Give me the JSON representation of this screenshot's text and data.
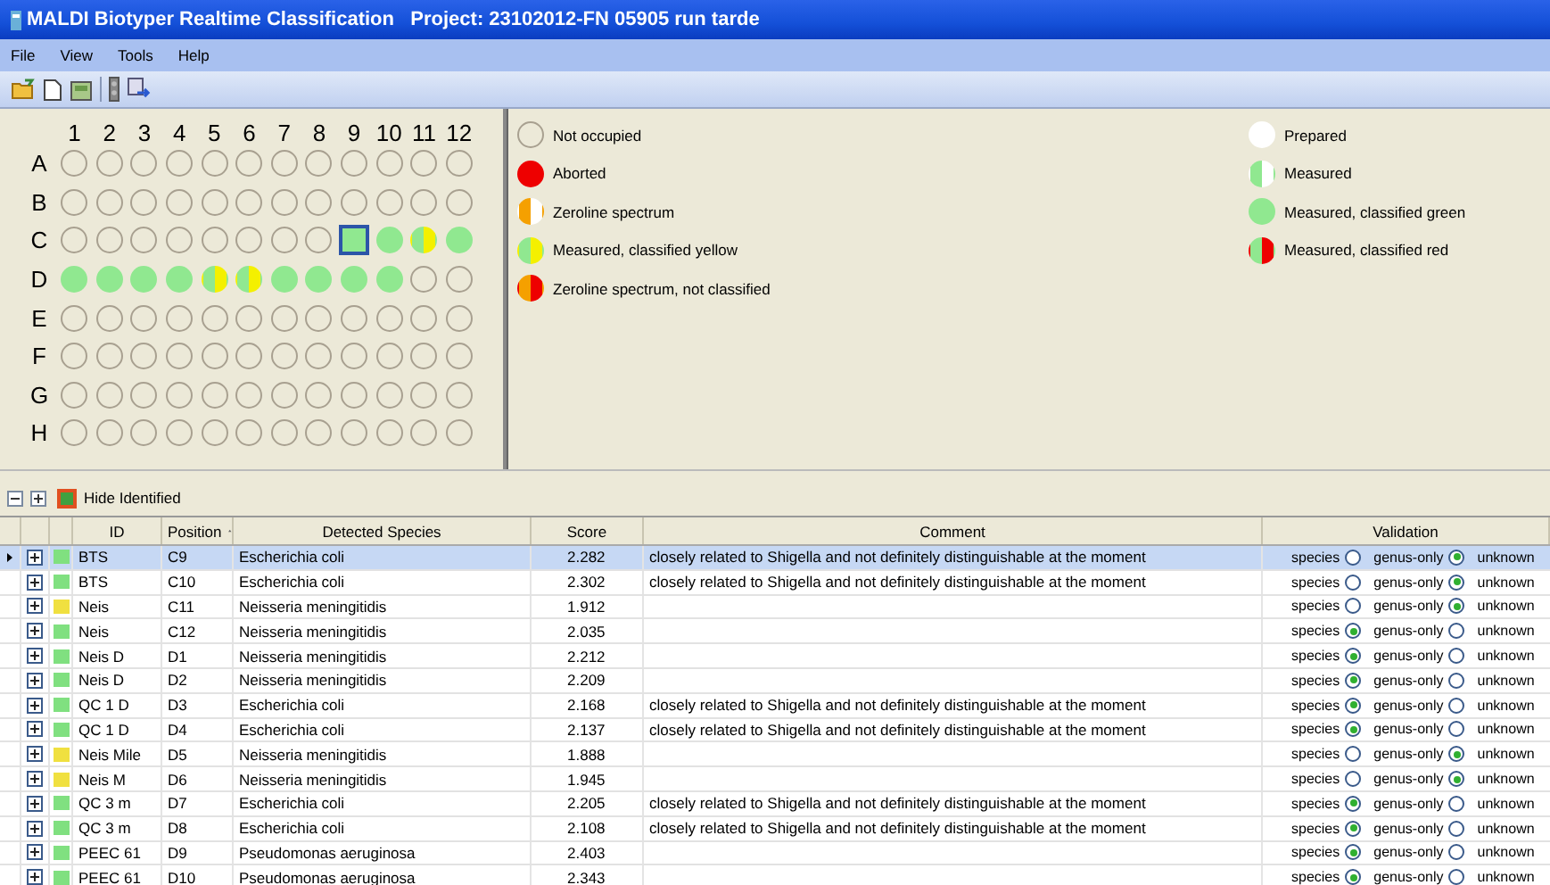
{
  "window": {
    "title": "MALDI Biotyper Realtime Classification   Project: 23102012-FN 05905 run tarde"
  },
  "menu": [
    "File",
    "View",
    "Tools",
    "Help"
  ],
  "plate": {
    "columns": [
      "1",
      "2",
      "3",
      "4",
      "5",
      "6",
      "7",
      "8",
      "9",
      "10",
      "11",
      "12"
    ],
    "rows": [
      {
        "label": "A",
        "wells": [
          {
            "kind": "empty",
            "selected": false
          },
          {
            "kind": "empty",
            "selected": false
          },
          {
            "kind": "empty",
            "selected": false
          },
          {
            "kind": "empty",
            "selected": false
          },
          {
            "kind": "empty",
            "selected": false
          },
          {
            "kind": "empty",
            "selected": false
          },
          {
            "kind": "empty",
            "selected": false
          },
          {
            "kind": "empty",
            "selected": false
          },
          {
            "kind": "empty",
            "selected": false
          },
          {
            "kind": "empty",
            "selected": false
          },
          {
            "kind": "empty",
            "selected": false
          },
          {
            "kind": "empty",
            "selected": false
          }
        ]
      },
      {
        "label": "B",
        "wells": [
          {
            "kind": "empty",
            "selected": false
          },
          {
            "kind": "empty",
            "selected": false
          },
          {
            "kind": "empty",
            "selected": false
          },
          {
            "kind": "empty",
            "selected": false
          },
          {
            "kind": "empty",
            "selected": false
          },
          {
            "kind": "empty",
            "selected": false
          },
          {
            "kind": "empty",
            "selected": false
          },
          {
            "kind": "empty",
            "selected": false
          },
          {
            "kind": "empty",
            "selected": false
          },
          {
            "kind": "empty",
            "selected": false
          },
          {
            "kind": "empty",
            "selected": false
          },
          {
            "kind": "empty",
            "selected": false
          }
        ]
      },
      {
        "label": "C",
        "wells": [
          {
            "kind": "empty",
            "selected": false
          },
          {
            "kind": "empty",
            "selected": false
          },
          {
            "kind": "empty",
            "selected": false
          },
          {
            "kind": "empty",
            "selected": false
          },
          {
            "kind": "empty",
            "selected": false
          },
          {
            "kind": "empty",
            "selected": false
          },
          {
            "kind": "empty",
            "selected": false
          },
          {
            "kind": "empty",
            "selected": false
          },
          {
            "kind": "green",
            "selected": true
          },
          {
            "kind": "green",
            "selected": false
          },
          {
            "kind": "green_yellow",
            "selected": false
          },
          {
            "kind": "green",
            "selected": false
          }
        ]
      },
      {
        "label": "D",
        "wells": [
          {
            "kind": "green",
            "selected": false
          },
          {
            "kind": "green",
            "selected": false
          },
          {
            "kind": "green",
            "selected": false
          },
          {
            "kind": "green",
            "selected": false
          },
          {
            "kind": "green_yellow",
            "selected": false
          },
          {
            "kind": "green_yellow",
            "selected": false
          },
          {
            "kind": "green",
            "selected": false
          },
          {
            "kind": "green",
            "selected": false
          },
          {
            "kind": "green",
            "selected": false
          },
          {
            "kind": "green",
            "selected": false
          },
          {
            "kind": "empty",
            "selected": false
          },
          {
            "kind": "empty",
            "selected": false
          }
        ]
      },
      {
        "label": "E",
        "wells": [
          {
            "kind": "empty",
            "selected": false
          },
          {
            "kind": "empty",
            "selected": false
          },
          {
            "kind": "empty",
            "selected": false
          },
          {
            "kind": "empty",
            "selected": false
          },
          {
            "kind": "empty",
            "selected": false
          },
          {
            "kind": "empty",
            "selected": false
          },
          {
            "kind": "empty",
            "selected": false
          },
          {
            "kind": "empty",
            "selected": false
          },
          {
            "kind": "empty",
            "selected": false
          },
          {
            "kind": "empty",
            "selected": false
          },
          {
            "kind": "empty",
            "selected": false
          },
          {
            "kind": "empty",
            "selected": false
          }
        ]
      },
      {
        "label": "F",
        "wells": [
          {
            "kind": "empty",
            "selected": false
          },
          {
            "kind": "empty",
            "selected": false
          },
          {
            "kind": "empty",
            "selected": false
          },
          {
            "kind": "empty",
            "selected": false
          },
          {
            "kind": "empty",
            "selected": false
          },
          {
            "kind": "empty",
            "selected": false
          },
          {
            "kind": "empty",
            "selected": false
          },
          {
            "kind": "empty",
            "selected": false
          },
          {
            "kind": "empty",
            "selected": false
          },
          {
            "kind": "empty",
            "selected": false
          },
          {
            "kind": "empty",
            "selected": false
          },
          {
            "kind": "empty",
            "selected": false
          }
        ]
      },
      {
        "label": "G",
        "wells": [
          {
            "kind": "empty",
            "selected": false
          },
          {
            "kind": "empty",
            "selected": false
          },
          {
            "kind": "empty",
            "selected": false
          },
          {
            "kind": "empty",
            "selected": false
          },
          {
            "kind": "empty",
            "selected": false
          },
          {
            "kind": "empty",
            "selected": false
          },
          {
            "kind": "empty",
            "selected": false
          },
          {
            "kind": "empty",
            "selected": false
          },
          {
            "kind": "empty",
            "selected": false
          },
          {
            "kind": "empty",
            "selected": false
          },
          {
            "kind": "empty",
            "selected": false
          },
          {
            "kind": "empty",
            "selected": false
          }
        ]
      },
      {
        "label": "H",
        "wells": [
          {
            "kind": "empty",
            "selected": false
          },
          {
            "kind": "empty",
            "selected": false
          },
          {
            "kind": "empty",
            "selected": false
          },
          {
            "kind": "empty",
            "selected": false
          },
          {
            "kind": "empty",
            "selected": false
          },
          {
            "kind": "empty",
            "selected": false
          },
          {
            "kind": "empty",
            "selected": false
          },
          {
            "kind": "empty",
            "selected": false
          },
          {
            "kind": "empty",
            "selected": false
          },
          {
            "kind": "empty",
            "selected": false
          },
          {
            "kind": "empty",
            "selected": false
          },
          {
            "kind": "empty",
            "selected": false
          }
        ]
      }
    ]
  },
  "legend": {
    "left": [
      {
        "kind": "empty",
        "label": "Not occupied"
      },
      {
        "kind": "red",
        "label": "Aborted"
      },
      {
        "kind": "orange_white",
        "label": "Zeroline spectrum"
      },
      {
        "kind": "green_yellow",
        "label": "Measured, classified yellow"
      },
      {
        "kind": "orange_red",
        "label": "Zeroline spectrum, not classified"
      }
    ],
    "right": [
      {
        "kind": "white",
        "label": "Prepared"
      },
      {
        "kind": "green_white",
        "label": "Measured"
      },
      {
        "kind": "green",
        "label": "Measured, classified green"
      },
      {
        "kind": "green_red",
        "label": "Measured, classified red"
      }
    ]
  },
  "grid_toolbar": {
    "label": "Hide Identified"
  },
  "table": {
    "columns": [
      "ID",
      "Position",
      "Detected Species",
      "Score",
      "Comment",
      "Validation"
    ],
    "rows": [
      {
        "selected": true,
        "color": "#80e080",
        "id": "BTS",
        "position": "C9",
        "species": "Escherichia coli",
        "score": "2.282",
        "comment": "closely related to Shigella and not definitely distinguishable at the moment",
        "choices": [
          {
            "label": "species",
            "selected": false
          },
          {
            "label": "genus-only",
            "selected": true
          }
        ],
        "third": "unknown"
      },
      {
        "selected": false,
        "color": "#80e080",
        "id": "BTS",
        "position": "C10",
        "species": "Escherichia coli",
        "score": "2.302",
        "comment": "closely related to Shigella and not definitely distinguishable at the moment",
        "choices": [
          {
            "label": "species",
            "selected": false
          },
          {
            "label": "genus-only",
            "selected": true
          }
        ],
        "third": "unknown"
      },
      {
        "selected": false,
        "color": "#f0e040",
        "id": "Neis",
        "position": "C11",
        "species": "Neisseria meningitidis",
        "score": "1.912",
        "comment": "",
        "choices": [
          {
            "label": "species",
            "selected": false
          },
          {
            "label": "genus-only",
            "selected": true
          }
        ],
        "third": "unknown"
      },
      {
        "selected": false,
        "color": "#80e080",
        "id": "Neis",
        "position": "C12",
        "species": "Neisseria meningitidis",
        "score": "2.035",
        "comment": "",
        "choices": [
          {
            "label": "species",
            "selected": true
          },
          {
            "label": "genus-only",
            "selected": false
          }
        ],
        "third": "unknown"
      },
      {
        "selected": false,
        "color": "#80e080",
        "id": "Neis D",
        "position": "D1",
        "species": "Neisseria meningitidis",
        "score": "2.212",
        "comment": "",
        "choices": [
          {
            "label": "species",
            "selected": true
          },
          {
            "label": "genus-only",
            "selected": false
          }
        ],
        "third": "unknown"
      },
      {
        "selected": false,
        "color": "#80e080",
        "id": "Neis D",
        "position": "D2",
        "species": "Neisseria meningitidis",
        "score": "2.209",
        "comment": "",
        "choices": [
          {
            "label": "species",
            "selected": true
          },
          {
            "label": "genus-only",
            "selected": false
          }
        ],
        "third": "unknown"
      },
      {
        "selected": false,
        "color": "#80e080",
        "id": "QC 1 D",
        "position": "D3",
        "species": "Escherichia coli",
        "score": "2.168",
        "comment": "closely related to Shigella and not definitely distinguishable at the moment",
        "choices": [
          {
            "label": "species",
            "selected": true
          },
          {
            "label": "genus-only",
            "selected": false
          }
        ],
        "third": "unknown"
      },
      {
        "selected": false,
        "color": "#80e080",
        "id": "QC 1 D",
        "position": "D4",
        "species": "Escherichia coli",
        "score": "2.137",
        "comment": "closely related to Shigella and not definitely distinguishable at the moment",
        "choices": [
          {
            "label": "species",
            "selected": true
          },
          {
            "label": "genus-only",
            "selected": false
          }
        ],
        "third": "unknown"
      },
      {
        "selected": false,
        "color": "#f0e040",
        "id": "Neis Mile",
        "position": "D5",
        "species": "Neisseria meningitidis",
        "score": "1.888",
        "comment": "",
        "choices": [
          {
            "label": "species",
            "selected": false
          },
          {
            "label": "genus-only",
            "selected": true
          }
        ],
        "third": "unknown"
      },
      {
        "selected": false,
        "color": "#f0e040",
        "id": "Neis M",
        "position": "D6",
        "species": "Neisseria meningitidis",
        "score": "1.945",
        "comment": "",
        "choices": [
          {
            "label": "species",
            "selected": false
          },
          {
            "label": "genus-only",
            "selected": true
          }
        ],
        "third": "unknown"
      },
      {
        "selected": false,
        "color": "#80e080",
        "id": "QC 3 m",
        "position": "D7",
        "species": "Escherichia coli",
        "score": "2.205",
        "comment": "closely related to Shigella and not definitely distinguishable at the moment",
        "choices": [
          {
            "label": "species",
            "selected": true
          },
          {
            "label": "genus-only",
            "selected": false
          }
        ],
        "third": "unknown"
      },
      {
        "selected": false,
        "color": "#80e080",
        "id": "QC 3 m",
        "position": "D8",
        "species": "Escherichia coli",
        "score": "2.108",
        "comment": "closely related to Shigella and not definitely distinguishable at the moment",
        "choices": [
          {
            "label": "species",
            "selected": true
          },
          {
            "label": "genus-only",
            "selected": false
          }
        ],
        "third": "unknown"
      },
      {
        "selected": false,
        "color": "#80e080",
        "id": "PEEC 61",
        "position": "D9",
        "species": "Pseudomonas aeruginosa",
        "score": "2.403",
        "comment": "",
        "choices": [
          {
            "label": "species",
            "selected": true
          },
          {
            "label": "genus-only",
            "selected": false
          }
        ],
        "third": "unknown"
      },
      {
        "selected": false,
        "color": "#80e080",
        "id": "PEEC 61",
        "position": "D10",
        "species": "Pseudomonas aeruginosa",
        "score": "2.343",
        "comment": "",
        "choices": [
          {
            "label": "species",
            "selected": true
          },
          {
            "label": "genus-only",
            "selected": false
          }
        ],
        "third": "unknown"
      }
    ]
  }
}
